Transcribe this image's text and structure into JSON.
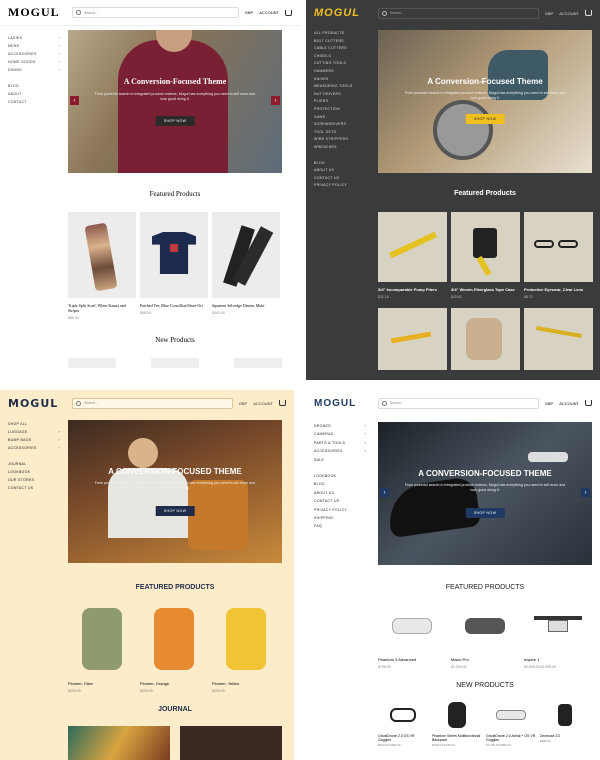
{
  "p1": {
    "logo": "MOGUL",
    "search_placeholder": "Search...",
    "currency": "GBP",
    "account": "ACCOUNT",
    "nav": [
      "LADIES",
      "MENS",
      "ACCESSORIES",
      "HOME GOODS",
      "DINING"
    ],
    "nav2": [
      "BLOG",
      "ABOUT",
      "CONTACT"
    ],
    "hero_title": "A Conversion-Focused Theme",
    "hero_sub": "From powerful search to integrated product reviews, Mogul has everything you need to sell more and look good doing it.",
    "hero_btn": "SHOP NOW",
    "featured": "Featured Products",
    "products": [
      {
        "name": "Triple Split Scarf, White Kasuri and Stripes",
        "price": "$86.00"
      },
      {
        "name": "Patched Tee, Blue Cross/Ikat/Shuri-Ori",
        "price": "$98.00"
      },
      {
        "name": "Japanese Selvedge Denim, Mubi",
        "price": "$340.00"
      }
    ],
    "new_products": "New Products"
  },
  "p2": {
    "logo": "MOGUL",
    "search_placeholder": "Search...",
    "currency": "GBP",
    "account": "ACCOUNT",
    "nav": [
      "ALL PRODUCTS",
      "BOLT CUTTERS",
      "CABLE CUTTERS",
      "CHISELS",
      "CUTTING TOOLS",
      "HAMMERS",
      "KNIVES",
      "MEASURING TOOLS",
      "NUT DRIVERS",
      "PLIERS",
      "PROTECTION",
      "SAWS",
      "SCREWDRIVERS",
      "TOOL SETS",
      "WIRE STRIPPERS",
      "WRENCHES"
    ],
    "nav2": [
      "BLOG",
      "ABOUT US",
      "CONTACT US",
      "PRIVACY POLICY"
    ],
    "hero_title": "A Conversion-Focused Theme",
    "hero_sub": "From powerful search to integrated product reviews, Mogul has everything you need to sell more and look good doing it.",
    "hero_btn": "SHOP NOW",
    "featured": "Featured Products",
    "products": [
      {
        "name": "3/4\" Incomparable Pump Pliers",
        "price": "$31.16"
      },
      {
        "name": "3/4\" Woven-Fiberglass Tape Case",
        "price": "$43.62"
      },
      {
        "name": "Protective Eyewear, Clear Lens",
        "price": "$8.72"
      }
    ]
  },
  "p3": {
    "logo": "MOGUL",
    "search_placeholder": "Search...",
    "currency": "GBP",
    "account": "ACCOUNT",
    "nav": [
      "SHOP ALL",
      "LUGGAGE",
      "BUMP BAGS",
      "ACCESSORIES"
    ],
    "nav2": [
      "JOURNAL",
      "LOOKBOOK",
      "OUR STORES",
      "CONTACT US"
    ],
    "hero_title": "A CONVERSION-FOCUSED THEME",
    "hero_sub": "From powerful search to integrated product reviews, Mogul has everything you need to sell more and look good doing it.",
    "hero_btn": "SHOP NOW",
    "featured": "FEATURED PRODUCTS",
    "products": [
      {
        "name": "Pioneer, Olive",
        "price": "$295.00"
      },
      {
        "name": "Pioneer, Orange",
        "price": "$295.00"
      },
      {
        "name": "Pioneer, Yellow",
        "price": "$295.00"
      }
    ],
    "journal": "JOURNAL"
  },
  "p4": {
    "logo": "MOGUL",
    "search_placeholder": "Search",
    "currency": "GBP",
    "account": "ACCOUNT",
    "nav": [
      "DRONES",
      "CAMERAS",
      "PARTS & TOOLS",
      "ACCESSORIES",
      "SALE"
    ],
    "nav2": [
      "LOOKBOOK",
      "BLOG",
      "ABOUT US",
      "CONTACT US",
      "PRIVACY POLICY",
      "SHIPPING",
      "FAQ"
    ],
    "hero_title": "A CONVERSION-FOCUSED THEME",
    "hero_sub": "From powerful search to integrated product reviews, Mogul has everything you need to sell more and look good doing it.",
    "hero_btn": "SHOP NOW",
    "featured": "FEATURED PRODUCTS",
    "products": [
      {
        "name": "Phantom 3 Advanced",
        "price": "$799.00"
      },
      {
        "name": "Mavic Pro",
        "price": "$1,299.00"
      },
      {
        "name": "Inspire 1",
        "price": "$2,899.00 $1,999.00"
      }
    ],
    "new_products": "NEW PRODUCTS",
    "new": [
      {
        "name": "GhostDrone 2.0 OS VR Goggles",
        "price": "$500.00 $399.99"
      },
      {
        "name": "Phantom Series Multifunctional Backpack",
        "price": "$199.00 $139.99"
      },
      {
        "name": "GhostDrone 2.0 Aerial + OS VR Goggles",
        "price": "$1,299.00 $899.00"
      },
      {
        "name": "Zenmuse Z3",
        "price": "$899.00"
      }
    ]
  }
}
